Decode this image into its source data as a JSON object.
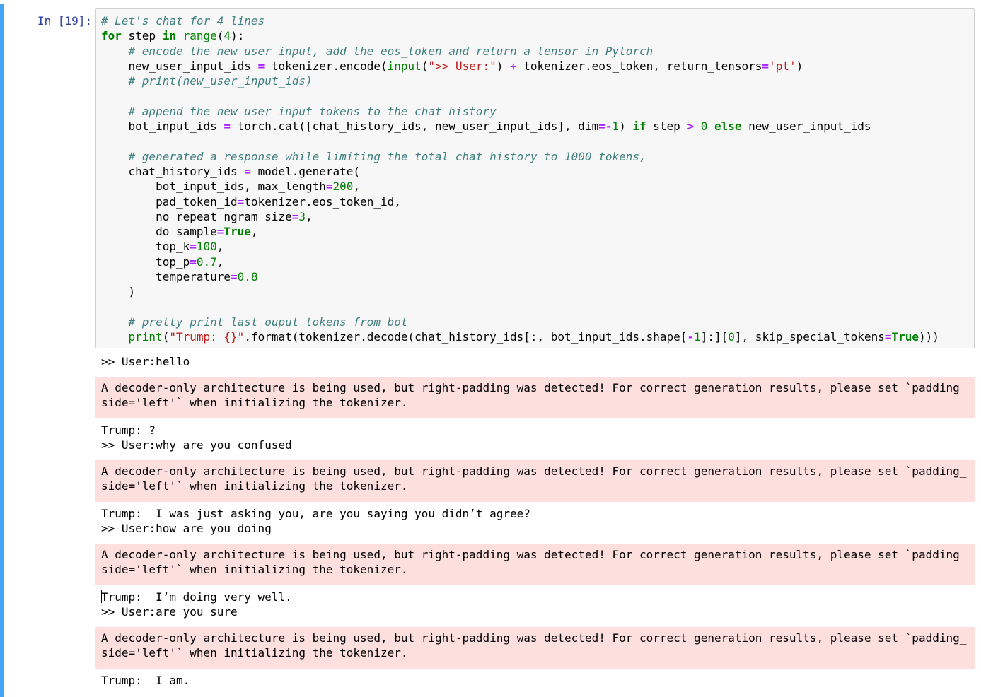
{
  "prompt_label": "In [19]:",
  "code_lines": {
    "l1": "# Let's chat for 4 lines",
    "l2_for": "for",
    "l2_step": " step ",
    "l2_in": "in",
    "l2_range": "range",
    "l2_open": "(",
    "l2_num": "4",
    "l2_close": "):",
    "l3": "    # encode the new user input, add the eos_token and return a tensor in Pytorch",
    "l4_a": "    new_user_input_ids ",
    "l4_eq": "=",
    "l4_b": " tokenizer.encode(",
    "l4_input": "input",
    "l4_c": "(",
    "l4_s1": "\">> User:\"",
    "l4_d": ") ",
    "l4_plus": "+",
    "l4_e": " tokenizer.eos_token, return_tensors",
    "l4_eq2": "=",
    "l4_s2": "'pt'",
    "l4_f": ")",
    "l5": "    # print(new_user_input_ids)",
    "l7": "    # append the new user input tokens to the chat history",
    "l8_a": "    bot_input_ids ",
    "l8_eq": "=",
    "l8_b": " torch.cat([chat_history_ids, new_user_input_ids], dim",
    "l8_eq2": "=-",
    "l8_n1": "1",
    "l8_c": ") ",
    "l8_if": "if",
    "l8_d": " step ",
    "l8_gt": ">",
    "l8_sp": " ",
    "l8_n0": "0",
    "l8_sp2": " ",
    "l8_else": "else",
    "l8_e": " new_user_input_ids",
    "l10": "    # generated a response while limiting the total chat history to 1000 tokens,",
    "l11_a": "    chat_history_ids ",
    "l11_eq": "=",
    "l11_b": " model.generate(",
    "l12_a": "        bot_input_ids, max_length",
    "l12_eq": "=",
    "l12_n": "200",
    "l12_b": ",",
    "l13_a": "        pad_token_id",
    "l13_eq": "=",
    "l13_b": "tokenizer.eos_token_id,",
    "l14_a": "        no_repeat_ngram_size",
    "l14_eq": "=",
    "l14_n": "3",
    "l14_b": ",",
    "l15_a": "        do_sample",
    "l15_eq": "=",
    "l15_t": "True",
    "l15_b": ",",
    "l16_a": "        top_k",
    "l16_eq": "=",
    "l16_n": "100",
    "l16_b": ",",
    "l17_a": "        top_p",
    "l17_eq": "=",
    "l17_n": "0.7",
    "l17_b": ",",
    "l18_a": "        temperature",
    "l18_eq": "=",
    "l18_n": "0.8",
    "l19": "    )",
    "l21": "    # pretty print last ouput tokens from bot",
    "l22_print": "print",
    "l22_a": "(",
    "l22_s": "\"Trump: {}\"",
    "l22_b": ".format(tokenizer.decode(chat_history_ids[:, bot_input_ids.shape[",
    "l22_minus": "-",
    "l22_n1": "1",
    "l22_c": "]:][",
    "l22_n0": "0",
    "l22_d": "], skip_special_tokens",
    "l22_eq": "=",
    "l22_t": "True",
    "l22_e": ")))"
  },
  "outputs": {
    "o1": ">> User:hello",
    "warn1": "A decoder-only architecture is being used, but right-padding was detected! For correct generation results, please set `padding_\nside='left'` when initializing the tokenizer.",
    "o2": "Trump: ?\n>> User:why are you confused",
    "warn2": "A decoder-only architecture is being used, but right-padding was detected! For correct generation results, please set `padding_\nside='left'` when initializing the tokenizer.",
    "o3": "Trump:  I was just asking you, are you saying you didn’t agree?\n>> User:how are you doing",
    "warn3": "A decoder-only architecture is being used, but right-padding was detected! For correct generation results, please set `padding_\nside='left'` when initializing the tokenizer.",
    "o4a": "Trump:  I’m doing very well.\n>> User:are you sure",
    "warn4": "A decoder-only architecture is being used, but right-padding was detected! For correct generation results, please set `padding_\nside='left'` when initializing the tokenizer.",
    "o5": "Trump:  I am."
  },
  "colors": {
    "selected_bar": "#42a5f5",
    "prompt": "#303f9f",
    "input_bg": "#f7f7f7",
    "stderr_bg": "#fddfdd",
    "comment": "#408080",
    "keyword": "#008000",
    "string": "#ba2121",
    "operator": "#aa22ff"
  }
}
